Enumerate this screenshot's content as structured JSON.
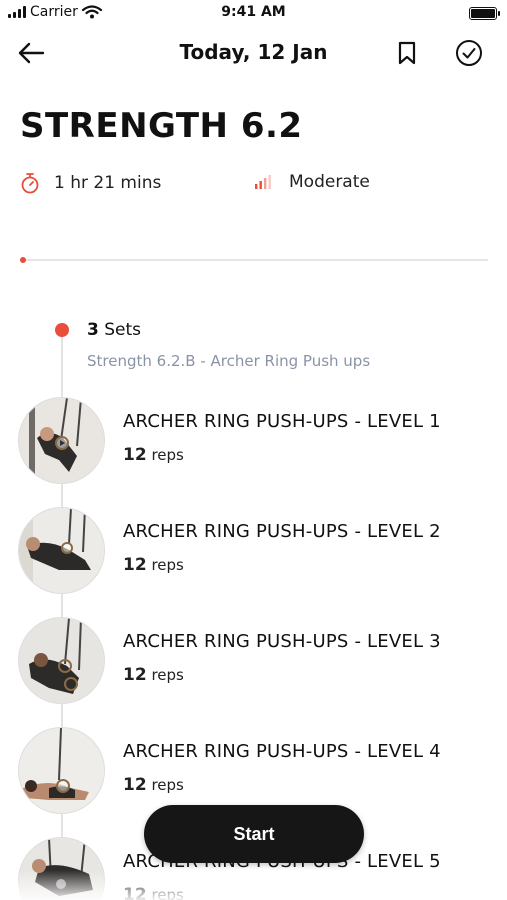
{
  "status_bar": {
    "carrier": "Carrier",
    "time": "9:41 AM"
  },
  "header": {
    "title": "Today, 12 Jan",
    "icons": [
      "back-arrow-icon",
      "bookmark-icon",
      "check-circle-icon"
    ]
  },
  "workout": {
    "title": "STRENGTH 6.2",
    "duration": "1 hr 21 mins",
    "difficulty": "Moderate",
    "accent_color": "#e94e3d",
    "progress": 0
  },
  "set": {
    "count": "3",
    "count_label": "Sets",
    "subtitle": "Strength 6.2.B - Archer Ring Push ups"
  },
  "exercises": [
    {
      "name": "ARCHER RING PUSH-UPS - LEVEL 1",
      "reps": "12",
      "reps_label": "reps"
    },
    {
      "name": "ARCHER RING PUSH-UPS - LEVEL 2",
      "reps": "12",
      "reps_label": "reps"
    },
    {
      "name": "ARCHER RING PUSH-UPS - LEVEL 3",
      "reps": "12",
      "reps_label": "reps"
    },
    {
      "name": "ARCHER RING PUSH-UPS - LEVEL 4",
      "reps": "12",
      "reps_label": "reps"
    },
    {
      "name": "ARCHER RING PUSH-UPS - LEVEL 5",
      "reps": "12",
      "reps_label": "reps"
    }
  ],
  "start_button": {
    "label": "Start"
  }
}
